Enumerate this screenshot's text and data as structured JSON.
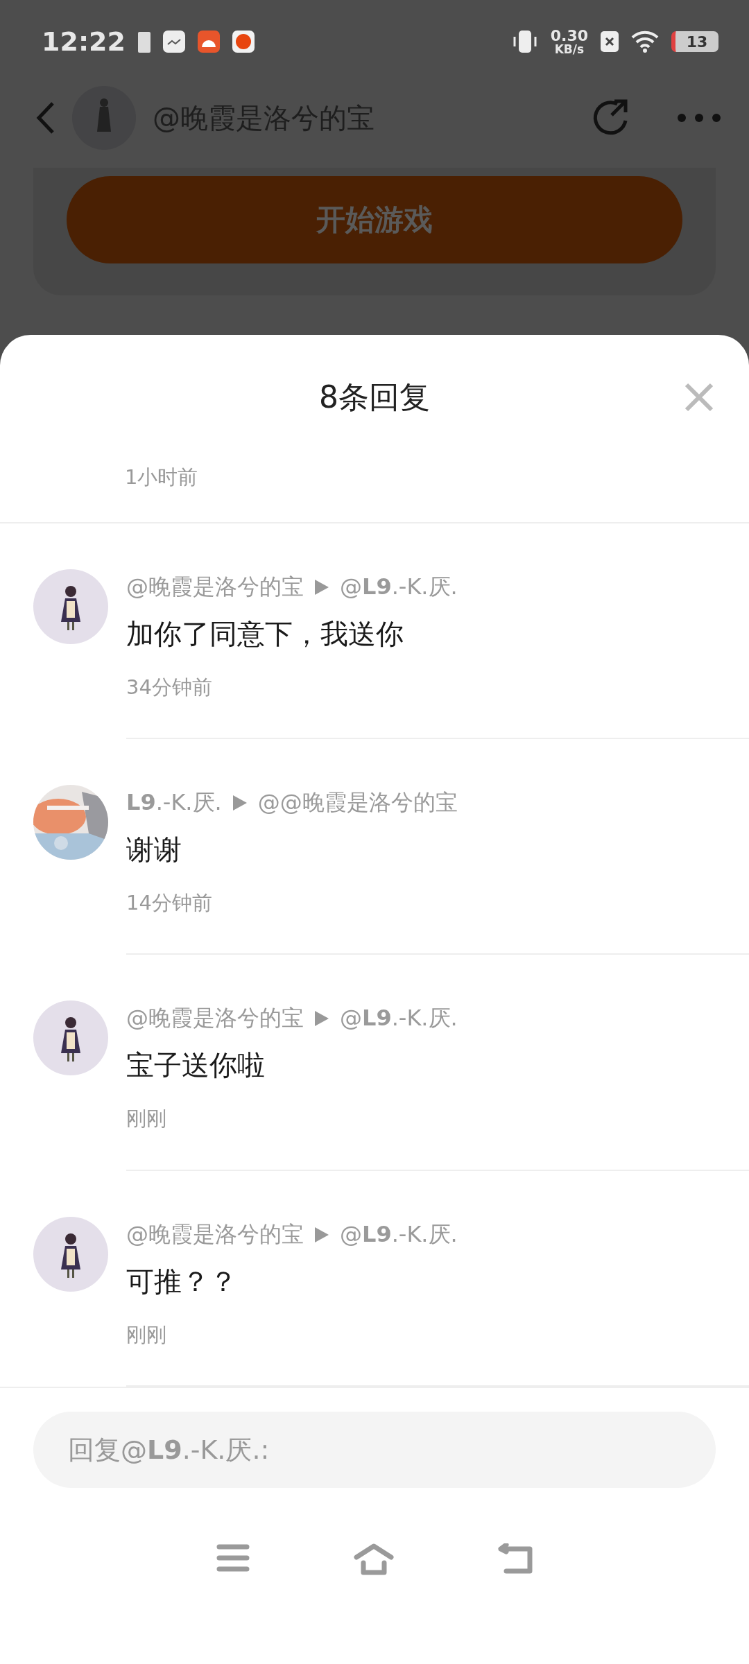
{
  "status_bar": {
    "time": "12:22",
    "net_speed": "0.30",
    "net_unit": "KB/s",
    "battery": "13"
  },
  "header": {
    "title": "@晚霞是洛兮的宝",
    "action_button": "开始游戏"
  },
  "sheet": {
    "title": "8条回复",
    "previous_time": "1小时前",
    "replies": [
      {
        "avatar": {
          "kind": "figure"
        },
        "author": "@晚霞是洛兮的宝",
        "target": "@**L9**.-K.厌.",
        "text": "加你了同意下，我送你",
        "time": "34分钟前"
      },
      {
        "author": "**L9**.-K.厌.",
        "target": "@@晚霞是洛兮的宝",
        "text": "谢谢",
        "time": "14分钟前"
      },
      {
        "avatar": {
          "kind": "figure"
        },
        "author": "@晚霞是洛兮的宝",
        "target": "@**L9**.-K.厌.",
        "text": "宝子送你啦",
        "time": "刚刚"
      },
      {
        "avatar": {
          "kind": "figure"
        },
        "author": "@晚霞是洛兮的宝",
        "target": "@**L9**.-K.厌.",
        "text": "可推？？",
        "time": "刚刚"
      }
    ]
  },
  "reply_box": {
    "placeholder": "回复@**L9**.-K.厌.:"
  }
}
